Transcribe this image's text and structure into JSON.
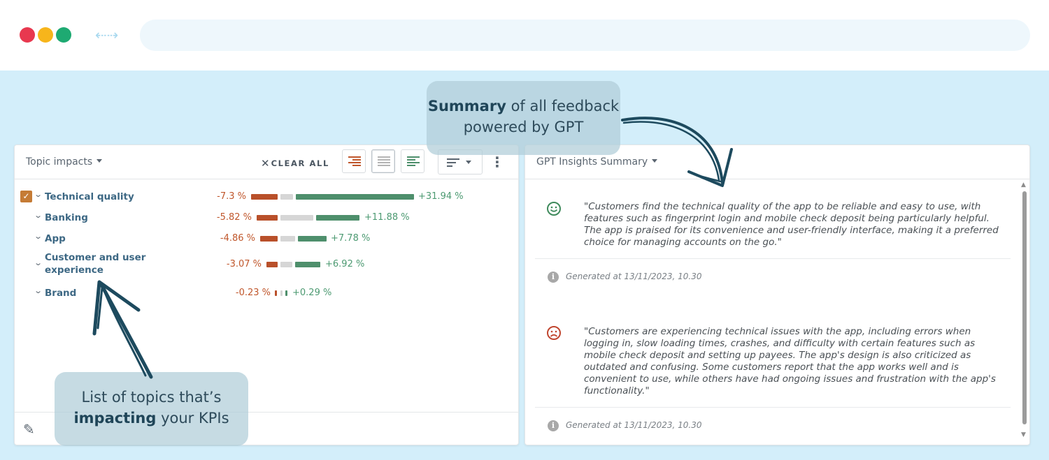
{
  "colors": {
    "accent_negative": "#b9502a",
    "accent_positive": "#4e8f6c",
    "topic_text": "#3d6884",
    "stage_background": "#d3eefa",
    "checkbox": "#c57b35"
  },
  "browser": {
    "nav_arrows": "⇠⇢"
  },
  "left_panel": {
    "title": "Topic impacts",
    "clear_all": "CLEAR ALL",
    "icons": [
      "align-right-icon",
      "align-center-icon",
      "align-left-icon",
      "sort-icon",
      "kebab-menu-icon",
      "pencil-icon"
    ],
    "topics": [
      {
        "name": "Technical quality",
        "negative": "-7.3 %",
        "positive": "+31.94 %",
        "neg_value": -7.3,
        "pos_value": 31.94,
        "checked": true
      },
      {
        "name": "Banking",
        "negative": "-5.82 %",
        "positive": "+11.88 %",
        "neg_value": -5.82,
        "pos_value": 11.88,
        "checked": false
      },
      {
        "name": "App",
        "negative": "-4.86 %",
        "positive": "+7.78 %",
        "neg_value": -4.86,
        "pos_value": 7.78,
        "checked": false
      },
      {
        "name_line1": "Customer and user",
        "name_line2": "experience",
        "negative": "-3.07 %",
        "positive": "+6.92 %",
        "neg_value": -3.07,
        "pos_value": 6.92,
        "checked": false
      },
      {
        "name": "Brand",
        "negative": "-0.23 %",
        "positive": "+0.29 %",
        "neg_value": -0.23,
        "pos_value": 0.29,
        "checked": false
      }
    ]
  },
  "right_panel": {
    "title": "GPT Insights Summary",
    "insights": [
      {
        "sentiment_icon": "smiley-happy-icon",
        "text": "\"Customers find the technical quality of the app to be reliable and easy to use, with features such as fingerprint login and mobile check deposit being particularly helpful. The app is praised for its convenience and user-friendly interface, making it a preferred choice for managing accounts on the go.\"",
        "generated": "Generated at 13/11/2023, 10.30"
      },
      {
        "sentiment_icon": "smiley-sad-icon",
        "text": "\"Customers are experiencing technical issues with the app, including errors when logging in, slow loading times, crashes, and difficulty with certain features such as mobile check deposit and setting up payees. The app's design is also criticized as outdated and confusing. Some customers report that the app works well and is convenient to use, while others have had ongoing issues and frustration with the app's functionality.\"",
        "generated": "Generated at 13/11/2023, 10.30"
      }
    ]
  },
  "callouts": {
    "top_bold": "Summary",
    "top_rest_line1": " of all feedback",
    "top_line2": "powered by GPT",
    "bottom_line1": "List of topics that’s",
    "bottom_bold": "impacting",
    "bottom_rest_line2": " your KPIs"
  }
}
